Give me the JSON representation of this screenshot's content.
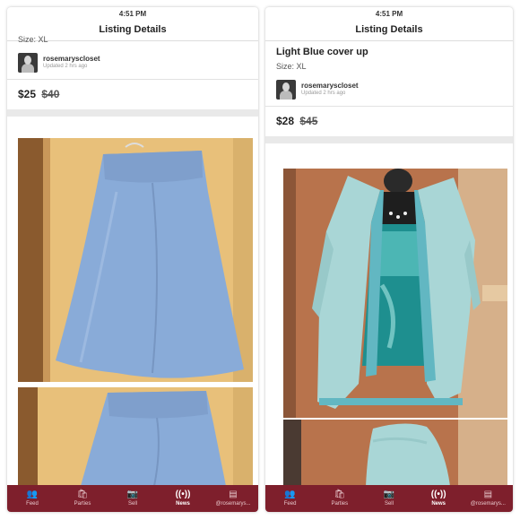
{
  "left": {
    "status_time": "4:51 PM",
    "nav_title": "Listing Details",
    "size": "Size: XL",
    "seller_name": "rosemaryscloset",
    "seller_updated": "Updated 2 hrs ago",
    "price": "$25",
    "original_price": "$40",
    "tabs": [
      {
        "label": "Feed",
        "icon": "people-icon",
        "glyph": "👥"
      },
      {
        "label": "Parties",
        "icon": "parties-icon",
        "glyph": "🛍"
      },
      {
        "label": "Sell",
        "icon": "camera-icon",
        "glyph": "📷"
      },
      {
        "label": "News",
        "icon": "news-icon",
        "glyph": "((•))"
      },
      {
        "label": "@rosemarys...",
        "icon": "closet-icon",
        "glyph": "▤"
      }
    ]
  },
  "right": {
    "status_time": "4:51 PM",
    "nav_title": "Listing Details",
    "item_title": "Light Blue cover up",
    "size": "Size: XL",
    "seller_name": "rosemaryscloset",
    "seller_updated": "Updated 2 hrs ago",
    "price": "$28",
    "original_price": "$45",
    "tabs": [
      {
        "label": "Feed",
        "icon": "people-icon",
        "glyph": "👥"
      },
      {
        "label": "Parties",
        "icon": "parties-icon",
        "glyph": "🛍"
      },
      {
        "label": "Sell",
        "icon": "camera-icon",
        "glyph": "📷"
      },
      {
        "label": "News",
        "icon": "news-icon",
        "glyph": "((•))"
      },
      {
        "label": "@rosemarys...",
        "icon": "closet-icon",
        "glyph": "▤"
      }
    ]
  },
  "colors": {
    "tab_bar": "#7e1f2c",
    "tab_active": "#ffffff",
    "skirt_blue": "#89abd8",
    "cardigan_aqua": "#a9d6d6"
  }
}
